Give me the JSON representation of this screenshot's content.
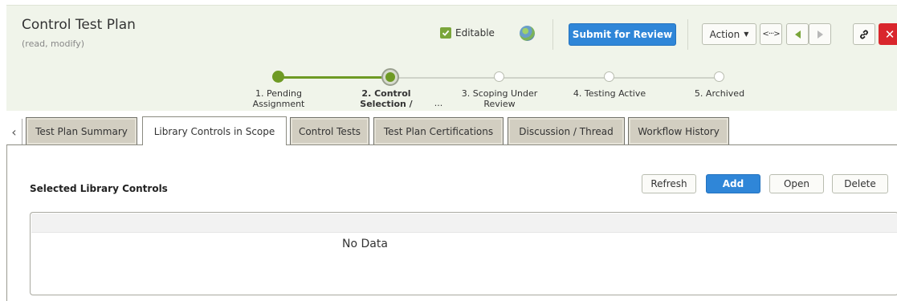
{
  "header": {
    "title": "Control Test Plan",
    "subtitle": "(read, modify)",
    "editable_label": "Editable",
    "editable_checked": true,
    "submit_label": "Submit for Review",
    "action_label": "Action",
    "expand_icon_text": "<···>"
  },
  "workflow": {
    "steps": [
      {
        "line1": "1. Pending",
        "line2": "Assignment",
        "status": "completed"
      },
      {
        "line1": "2. Control",
        "line2": "Selection /",
        "extra": "...",
        "status": "current"
      },
      {
        "line1": "3. Scoping Under",
        "line2": "Review",
        "status": "pending"
      },
      {
        "line1": "4. Testing Active",
        "line2": "",
        "status": "pending"
      },
      {
        "line1": "5. Archived",
        "line2": "",
        "status": "pending"
      }
    ]
  },
  "tabs": [
    {
      "label": "Test Plan Summary",
      "active": false
    },
    {
      "label": "Library Controls in Scope",
      "active": true
    },
    {
      "label": "Control Tests",
      "active": false
    },
    {
      "label": "Test Plan Certifications",
      "active": false
    },
    {
      "label": "Discussion / Thread",
      "active": false
    },
    {
      "label": "Workflow History",
      "active": false
    }
  ],
  "content": {
    "section_title": "Selected Library Controls",
    "buttons": {
      "refresh": "Refresh",
      "add": "Add",
      "open": "Open",
      "delete": "Delete"
    },
    "grid_empty_text": "No Data"
  },
  "colors": {
    "accent_green": "#7aa53a",
    "primary_blue": "#2f86d8",
    "close_red": "#d9262c",
    "header_bg": "#f0f4ea"
  },
  "icons": [
    "checkbox-checked-icon",
    "globe-icon",
    "caret-down-icon",
    "expand-icon",
    "previous-icon",
    "next-icon",
    "link-icon",
    "close-icon",
    "chevron-left-icon"
  ]
}
